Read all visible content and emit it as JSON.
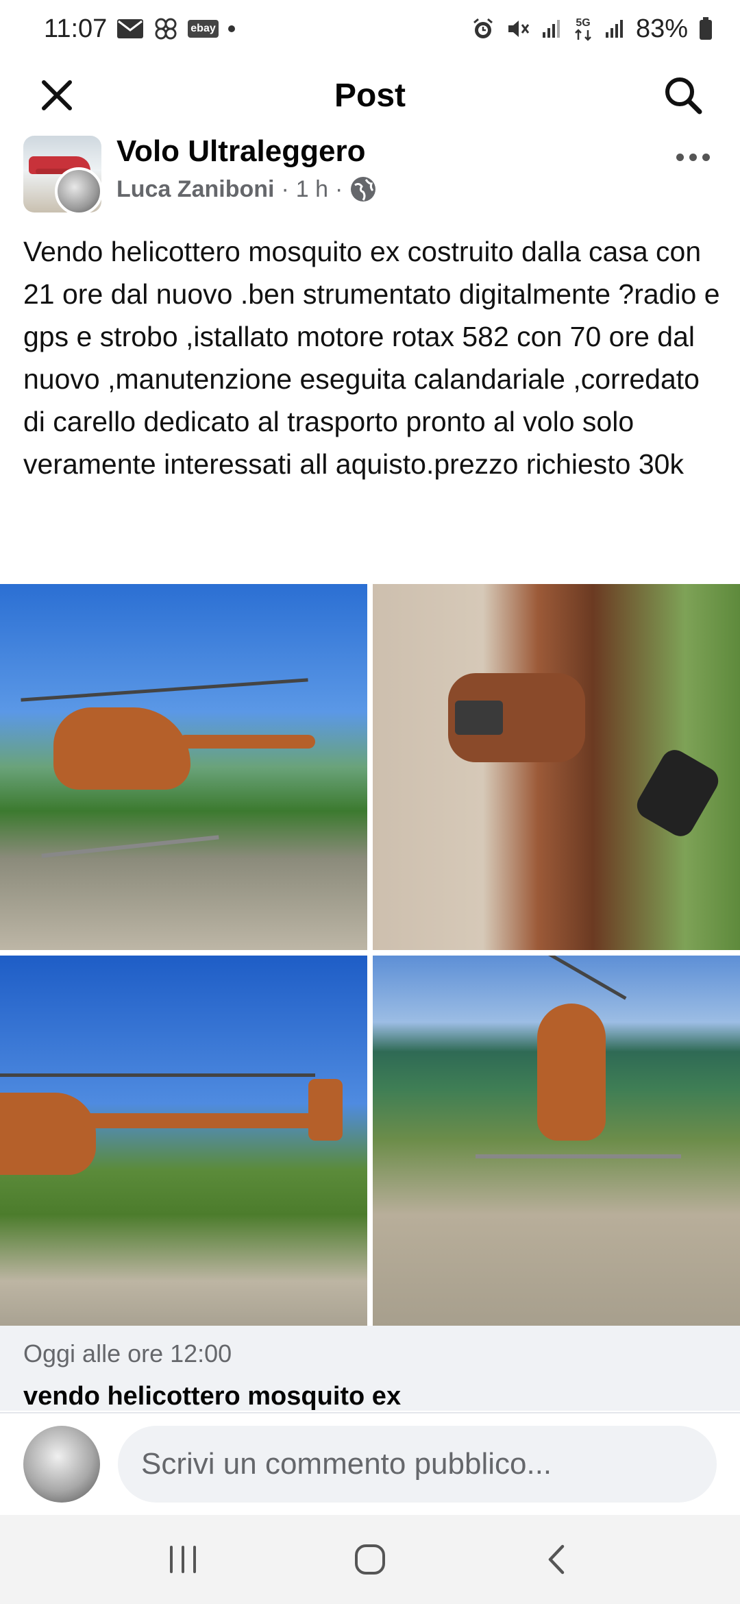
{
  "status_bar": {
    "time": "11:07",
    "left_icons": [
      "mail-icon",
      "pinwheel-icon",
      "ebay-icon",
      "dot-icon"
    ],
    "ebay_label": "ebay",
    "right_icons": [
      "alarm-icon",
      "mute-icon",
      "signal-icon",
      "5g-icon",
      "signal-icon",
      "battery-icon"
    ],
    "network": "5G",
    "battery": "83%"
  },
  "header": {
    "title": "Post",
    "close_icon": "close-icon",
    "search_icon": "search-icon"
  },
  "post": {
    "group_name": "Volo Ultraleggero",
    "author": "Luca Zaniboni",
    "time": "1 h",
    "separator": "·",
    "audience_icon": "globe-icon",
    "text": "Vendo helicottero mosquito ex costruito dalla casa con 21 ore dal nuovo .ben strumentato digitalmente ?radio e gps e strobo ,istallato motore rotax 582 con 70 ore dal nuovo ,manutenzione eseguita calandariale ,corredato di carello dedicato al trasporto pronto al volo solo veramente interessati all aquisto.prezzo richiesto 30k",
    "photo_count": 4
  },
  "link_preview": {
    "meta": "Oggi alle ore 12:00",
    "title": "vendo helicottero mosquito ex"
  },
  "comment": {
    "placeholder": "Scrivi un commento pubblico..."
  },
  "nav": {
    "icons": [
      "recent-apps-icon",
      "home-icon",
      "back-icon"
    ]
  },
  "colors": {
    "text_primary": "#050505",
    "text_secondary": "#65676b",
    "input_bg": "#f0f2f5"
  }
}
